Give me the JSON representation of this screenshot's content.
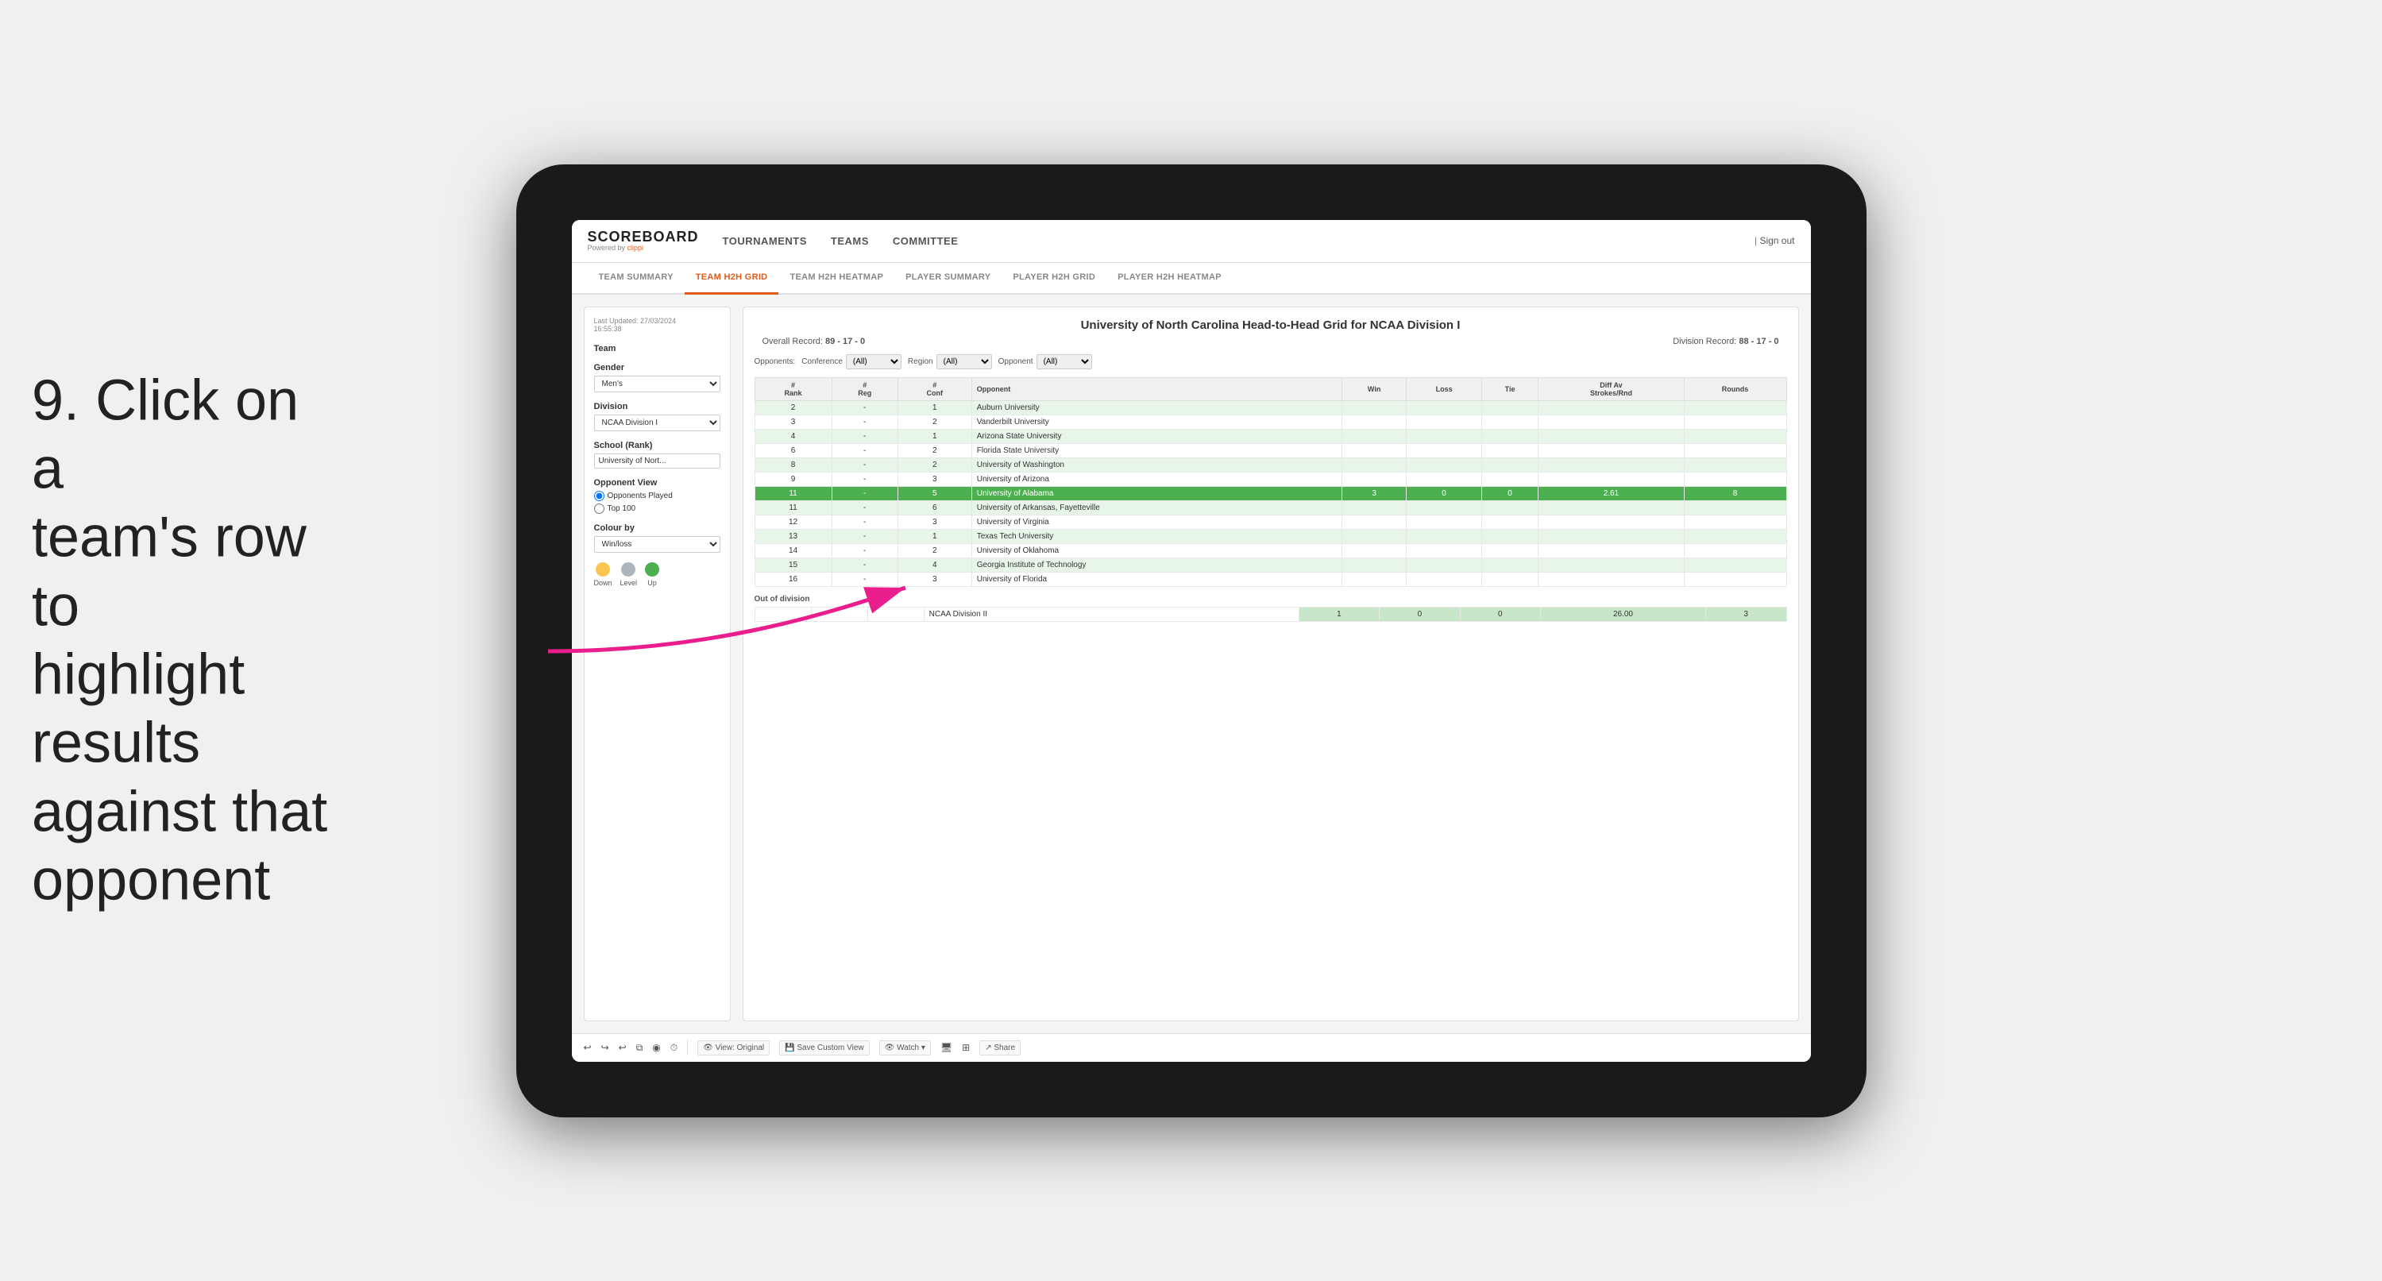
{
  "annotation": {
    "number": "9.",
    "line1": "Click on a",
    "line2": "team's row to",
    "line3": "highlight results",
    "line4": "against that",
    "line5": "opponent"
  },
  "nav": {
    "logo": "SCOREBOARD",
    "logo_sub": "Powered by ",
    "logo_brand": "clippi",
    "links": [
      "TOURNAMENTS",
      "TEAMS",
      "COMMITTEE"
    ],
    "sign_out": "Sign out"
  },
  "tabs": [
    {
      "label": "TEAM SUMMARY",
      "active": false
    },
    {
      "label": "TEAM H2H GRID",
      "active": true
    },
    {
      "label": "TEAM H2H HEATMAP",
      "active": false
    },
    {
      "label": "PLAYER SUMMARY",
      "active": false
    },
    {
      "label": "PLAYER H2H GRID",
      "active": false
    },
    {
      "label": "PLAYER H2H HEATMAP",
      "active": false
    }
  ],
  "left_panel": {
    "last_updated_label": "Last Updated: 27/03/2024",
    "last_updated_time": "16:55:38",
    "team_label": "Team",
    "gender_label": "Gender",
    "gender_value": "Men's",
    "division_label": "Division",
    "division_value": "NCAA Division I",
    "school_label": "School (Rank)",
    "school_value": "University of Nort...",
    "opponent_view_label": "Opponent View",
    "radio_opponents": "Opponents Played",
    "radio_top100": "Top 100",
    "colour_by_label": "Colour by",
    "colour_by_value": "Win/loss",
    "legend_down": "Down",
    "legend_level": "Level",
    "legend_up": "Up",
    "legend_down_color": "#f9c74f",
    "legend_level_color": "#adb5bd",
    "legend_up_color": "#4caf50"
  },
  "grid": {
    "title": "University of North Carolina Head-to-Head Grid for NCAA Division I",
    "overall_record_label": "Overall Record:",
    "overall_record": "89 - 17 - 0",
    "division_record_label": "Division Record:",
    "division_record": "88 - 17 - 0",
    "filters": {
      "opponents_label": "Opponents:",
      "conference_label": "Conference",
      "conference_value": "(All)",
      "region_label": "Region",
      "region_value": "(All)",
      "opponent_label": "Opponent",
      "opponent_value": "(All)"
    },
    "columns": [
      "#\nRank",
      "#\nReg",
      "#\nConf",
      "Opponent",
      "Win",
      "Loss",
      "Tie",
      "Diff Av\nStrokes/Rnd",
      "Rounds"
    ],
    "rows": [
      {
        "rank": "2",
        "reg": "-",
        "conf": "1",
        "opponent": "Auburn University",
        "win": "",
        "loss": "",
        "tie": "",
        "diff": "",
        "rounds": "",
        "highlight": "light"
      },
      {
        "rank": "3",
        "reg": "-",
        "conf": "2",
        "opponent": "Vanderbilt University",
        "win": "",
        "loss": "",
        "tie": "",
        "diff": "",
        "rounds": "",
        "highlight": "none"
      },
      {
        "rank": "4",
        "reg": "-",
        "conf": "1",
        "opponent": "Arizona State University",
        "win": "",
        "loss": "",
        "tie": "",
        "diff": "",
        "rounds": "",
        "highlight": "light"
      },
      {
        "rank": "6",
        "reg": "-",
        "conf": "2",
        "opponent": "Florida State University",
        "win": "",
        "loss": "",
        "tie": "",
        "diff": "",
        "rounds": "",
        "highlight": "none"
      },
      {
        "rank": "8",
        "reg": "-",
        "conf": "2",
        "opponent": "University of Washington",
        "win": "",
        "loss": "",
        "tie": "",
        "diff": "",
        "rounds": "",
        "highlight": "light"
      },
      {
        "rank": "9",
        "reg": "-",
        "conf": "3",
        "opponent": "University of Arizona",
        "win": "",
        "loss": "",
        "tie": "",
        "diff": "",
        "rounds": "",
        "highlight": "none"
      },
      {
        "rank": "11",
        "reg": "-",
        "conf": "5",
        "opponent": "University of Alabama",
        "win": "3",
        "loss": "0",
        "tie": "0",
        "diff": "2.61",
        "rounds": "8",
        "highlight": "selected"
      },
      {
        "rank": "11",
        "reg": "-",
        "conf": "6",
        "opponent": "University of Arkansas, Fayetteville",
        "win": "",
        "loss": "",
        "tie": "",
        "diff": "",
        "rounds": "",
        "highlight": "light"
      },
      {
        "rank": "12",
        "reg": "-",
        "conf": "3",
        "opponent": "University of Virginia",
        "win": "",
        "loss": "",
        "tie": "",
        "diff": "",
        "rounds": "",
        "highlight": "none"
      },
      {
        "rank": "13",
        "reg": "-",
        "conf": "1",
        "opponent": "Texas Tech University",
        "win": "",
        "loss": "",
        "tie": "",
        "diff": "",
        "rounds": "",
        "highlight": "light"
      },
      {
        "rank": "14",
        "reg": "-",
        "conf": "2",
        "opponent": "University of Oklahoma",
        "win": "",
        "loss": "",
        "tie": "",
        "diff": "",
        "rounds": "",
        "highlight": "none"
      },
      {
        "rank": "15",
        "reg": "-",
        "conf": "4",
        "opponent": "Georgia Institute of Technology",
        "win": "",
        "loss": "",
        "tie": "",
        "diff": "",
        "rounds": "",
        "highlight": "light"
      },
      {
        "rank": "16",
        "reg": "-",
        "conf": "3",
        "opponent": "University of Florida",
        "win": "",
        "loss": "",
        "tie": "",
        "diff": "",
        "rounds": "",
        "highlight": "none"
      }
    ],
    "out_of_division_label": "Out of division",
    "out_rows": [
      {
        "name": "NCAA Division II",
        "win": "1",
        "loss": "0",
        "tie": "0",
        "diff": "26.00",
        "rounds": "3"
      }
    ]
  },
  "toolbar": {
    "buttons": [
      "View: Original",
      "Save Custom View",
      "Watch ▾",
      "Share"
    ],
    "icons": [
      "↩",
      "↪",
      "↩",
      "⧉",
      "◉",
      "⏱"
    ]
  }
}
